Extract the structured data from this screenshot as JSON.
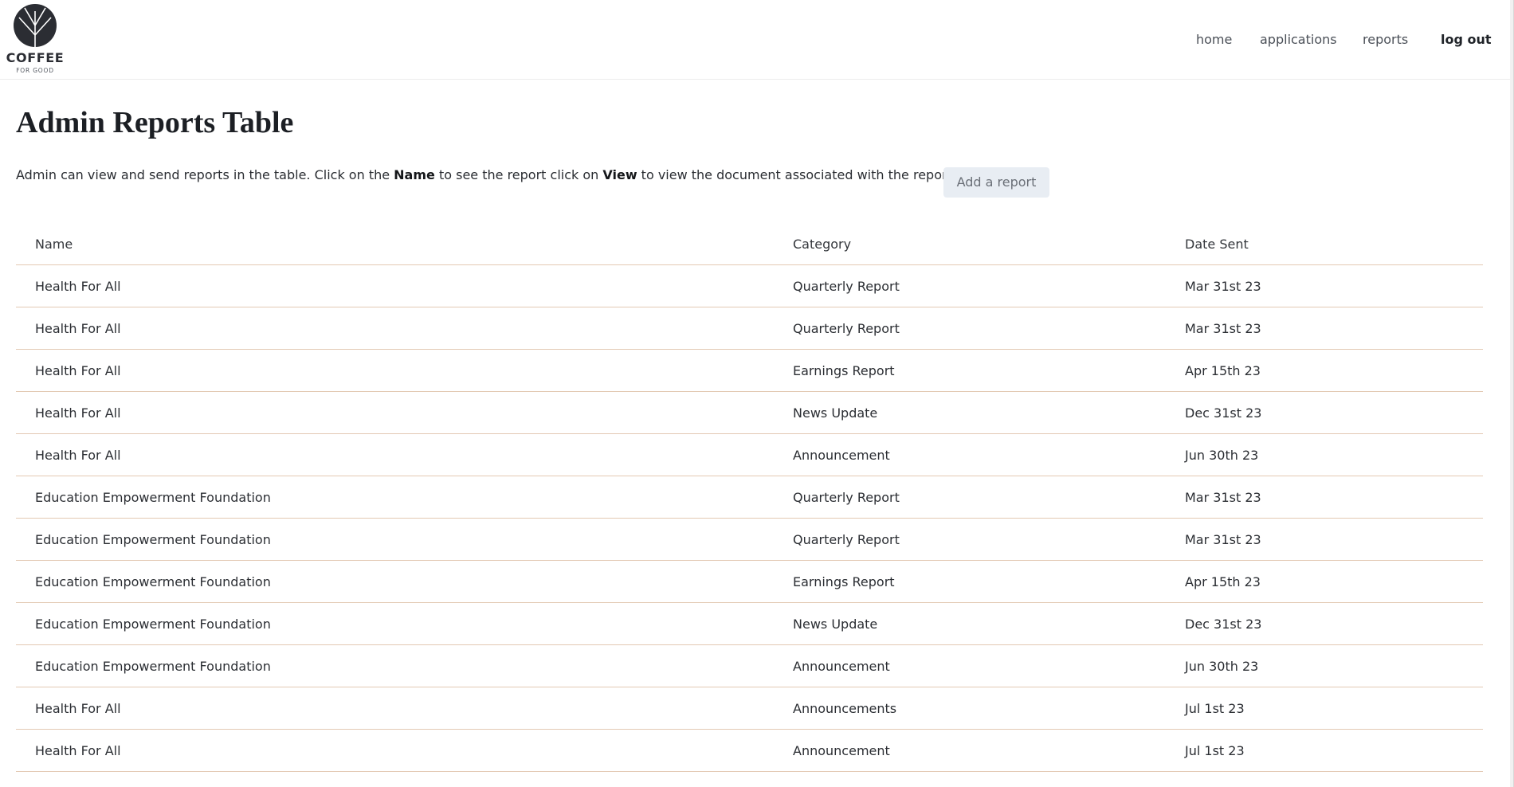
{
  "brand": {
    "name": "COFFEE",
    "tagline": "FOR GOOD"
  },
  "nav": {
    "items": [
      {
        "label": "home"
      },
      {
        "label": "applications"
      },
      {
        "label": "reports"
      }
    ],
    "logout": "log out"
  },
  "page": {
    "title": "Admin Reports Table",
    "description": {
      "part1": "Admin can view and send reports in the table. Click on the ",
      "bold1": "Name",
      "part2": " to see the report click on ",
      "bold2": "View",
      "part3": " to view the document associated with the report."
    },
    "add_button": "Add a report"
  },
  "table": {
    "headers": [
      "Name",
      "Category",
      "Date Sent"
    ],
    "rows": [
      [
        "Health For All",
        "Quarterly Report",
        "Mar 31st 23"
      ],
      [
        "Health For All",
        "Quarterly Report",
        "Mar 31st 23"
      ],
      [
        "Health For All",
        "Earnings Report",
        "Apr 15th 23"
      ],
      [
        "Health For All",
        "News Update",
        "Dec 31st 23"
      ],
      [
        "Health For All",
        "Announcement",
        "Jun 30th 23"
      ],
      [
        "Education Empowerment Foundation",
        "Quarterly Report",
        "Mar 31st 23"
      ],
      [
        "Education Empowerment Foundation",
        "Quarterly Report",
        "Mar 31st 23"
      ],
      [
        "Education Empowerment Foundation",
        "Earnings Report",
        "Apr 15th 23"
      ],
      [
        "Education Empowerment Foundation",
        "News Update",
        "Dec 31st 23"
      ],
      [
        "Education Empowerment Foundation",
        "Announcement",
        "Jun 30th 23"
      ],
      [
        "Health For All",
        "Announcements",
        "Jul 1st 23"
      ],
      [
        "Health For All",
        "Announcement",
        "Jul 1st 23"
      ]
    ]
  },
  "colors": {
    "row_border": "#e3c9b3",
    "button_bg": "#e8edf3",
    "logo": "#2b2d33"
  }
}
